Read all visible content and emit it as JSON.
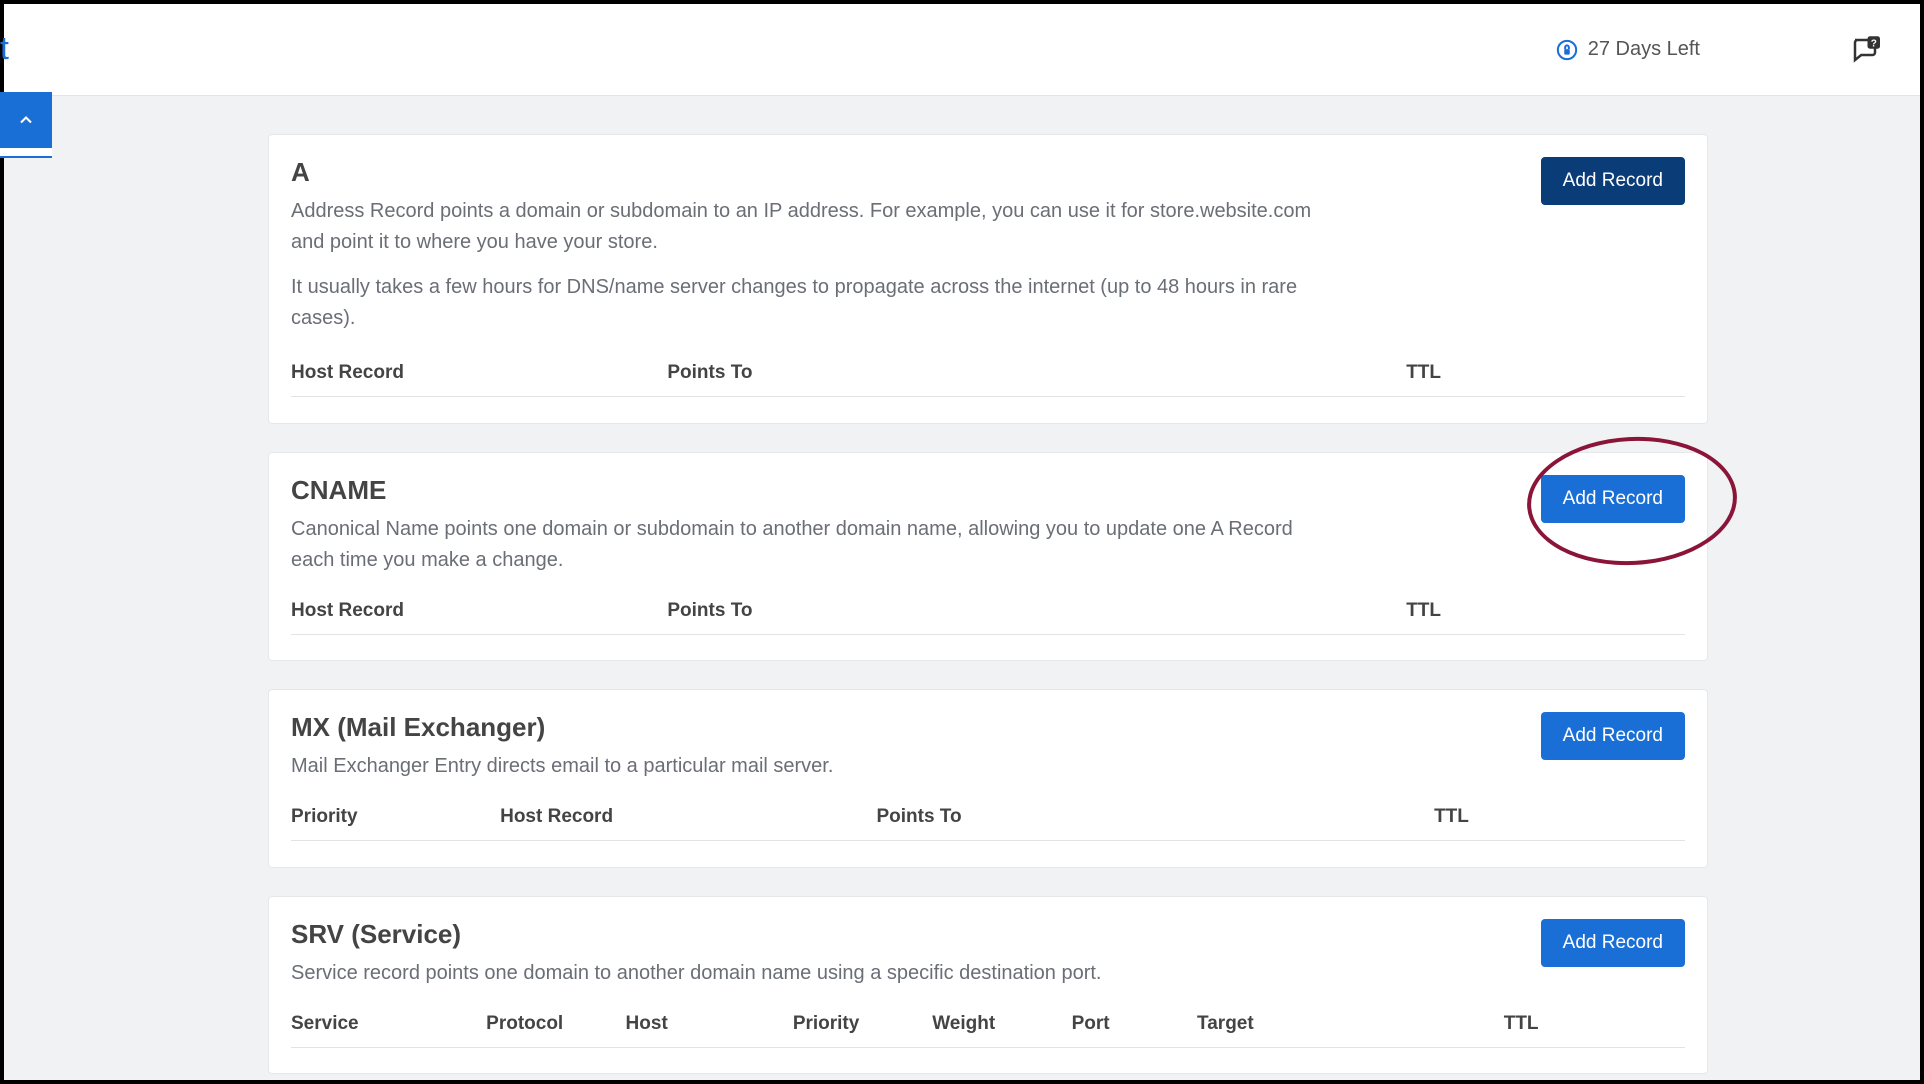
{
  "header": {
    "trial_text": "27 Days Left"
  },
  "sections": {
    "a": {
      "title": "A",
      "desc": "Address Record points a domain or subdomain to an IP address. For example, you can use it for store.website.com and point it to where you have your store.",
      "desc2": "It usually takes a few hours for DNS/name server changes to propagate across the internet (up to 48 hours in rare cases).",
      "add_label": "Add Record",
      "cols": {
        "host": "Host Record",
        "points": "Points To",
        "ttl": "TTL"
      }
    },
    "cname": {
      "title": "CNAME",
      "desc": "Canonical Name points one domain or subdomain to another domain name, allowing you to update one A Record each time you make a change.",
      "add_label": "Add Record",
      "cols": {
        "host": "Host Record",
        "points": "Points To",
        "ttl": "TTL"
      }
    },
    "mx": {
      "title": "MX (Mail Exchanger)",
      "desc": "Mail Exchanger Entry directs email to a particular mail server.",
      "add_label": "Add Record",
      "cols": {
        "priority": "Priority",
        "host": "Host Record",
        "points": "Points To",
        "ttl": "TTL"
      }
    },
    "srv": {
      "title": "SRV (Service)",
      "desc": "Service record points one domain to another domain name using a specific destination port.",
      "add_label": "Add Record",
      "cols": {
        "service": "Service",
        "protocol": "Protocol",
        "host": "Host",
        "priority": "Priority",
        "weight": "Weight",
        "port": "Port",
        "target": "Target",
        "ttl": "TTL"
      }
    }
  }
}
